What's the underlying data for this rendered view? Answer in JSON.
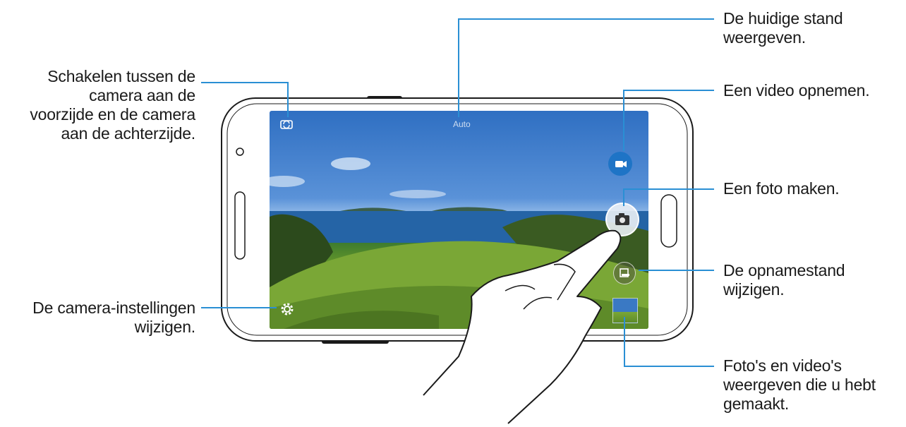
{
  "labels": {
    "switch_camera": "Schakelen tussen de\ncamera aan de\nvoorzijde en de camera\naan de achterzijde.",
    "settings": "De camera-instellingen\nwijzigen.",
    "current_mode": "De huidige stand\nweergeven.",
    "record_video": "Een video opnemen.",
    "take_photo": "Een foto maken.",
    "change_mode": "De opnamestand\nwijzigen.",
    "gallery": "Foto's en video's\nweergeven die u hebt\ngemaakt."
  },
  "screen": {
    "mode_text": "Auto"
  },
  "icons": {
    "switch": "camera-switch-icon",
    "settings": "gear-icon",
    "video": "video-camera-icon",
    "photo": "camera-icon",
    "mode": "mode-icon",
    "gallery": "gallery-thumbnail-icon"
  },
  "colors": {
    "callout_line": "#2a8fd4",
    "button_blue": "#1e74c6"
  }
}
